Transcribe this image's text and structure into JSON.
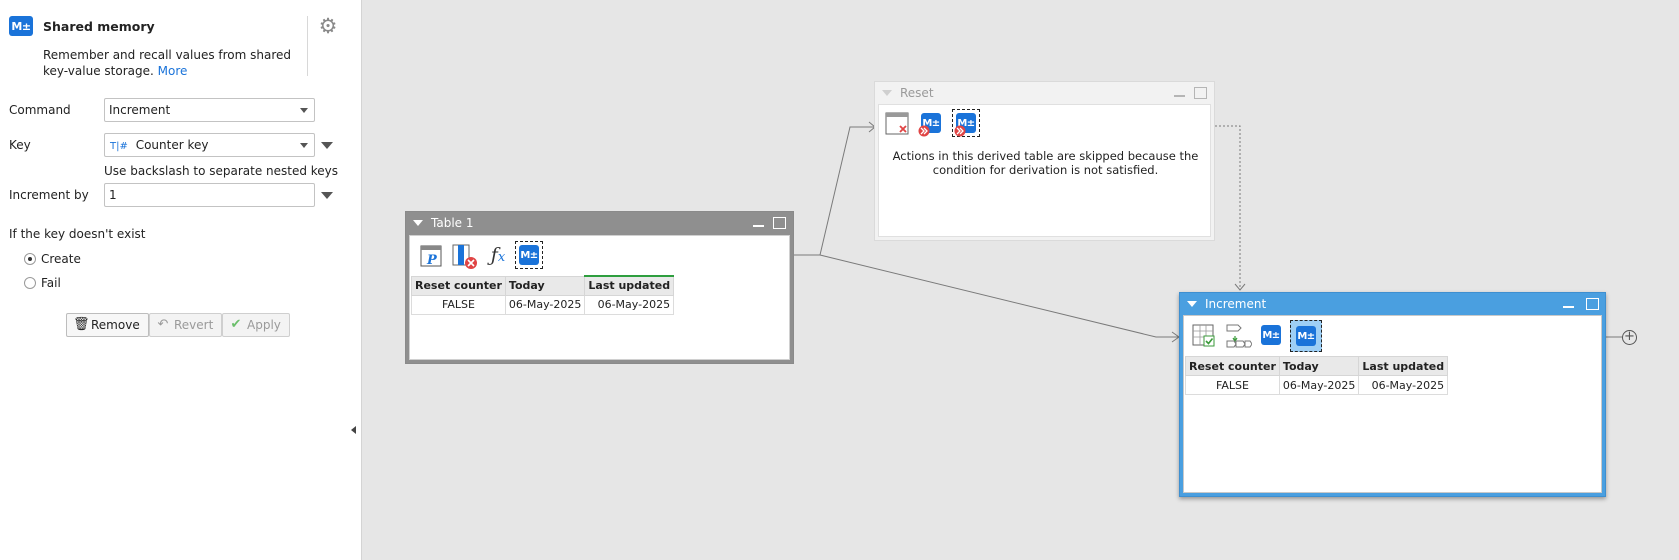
{
  "panel": {
    "title": "Shared memory",
    "icon_text": "M±",
    "description": "Remember and recall values from shared key-value storage.",
    "more_link": "More",
    "command": {
      "label": "Command",
      "value": "Increment"
    },
    "key": {
      "label": "Key",
      "type_glyph": "T|#",
      "value": "Counter key"
    },
    "key_hint": "Use backslash to separate nested keys",
    "increment": {
      "label": "Increment by",
      "value": "1"
    },
    "missing_section": "If the key doesn't exist",
    "options": [
      {
        "label": "Create",
        "selected": true
      },
      {
        "label": "Fail",
        "selected": false
      }
    ],
    "buttons": {
      "remove": "Remove",
      "revert": "Revert",
      "apply": "Apply"
    }
  },
  "nodes": {
    "table1": {
      "title": "Table 1",
      "columns": [
        "Reset counter",
        "Today",
        "Last updated"
      ],
      "rows": [
        [
          "FALSE",
          "06-May-2025",
          "06-May-2025"
        ]
      ]
    },
    "reset": {
      "title": "Reset",
      "message_line1": "Actions in this derived table are skipped because the",
      "message_line2": "condition for derivation is not satisfied."
    },
    "increment": {
      "title": "Increment",
      "columns": [
        "Reset counter",
        "Today",
        "Last updated"
      ],
      "rows": [
        [
          "FALSE",
          "06-May-2025",
          "06-May-2025"
        ]
      ]
    }
  },
  "colors": {
    "accent": "#1a73d9",
    "table1_header": "#8f8f8f",
    "reset_header": "#f2f2f2",
    "increment_header": "#4a9fe0",
    "selected_tool": "#9ecff5",
    "last_updated_marker": "#2e9e3e"
  },
  "icons": [
    "shared-memory-icon",
    "gear-icon",
    "dropdown-caret-icon",
    "trash-icon",
    "undo-icon",
    "check-icon",
    "parameter-icon",
    "delete-column-icon",
    "function-icon",
    "check-table-icon",
    "flow-steps-icon",
    "skip-icon",
    "add-icon"
  ]
}
